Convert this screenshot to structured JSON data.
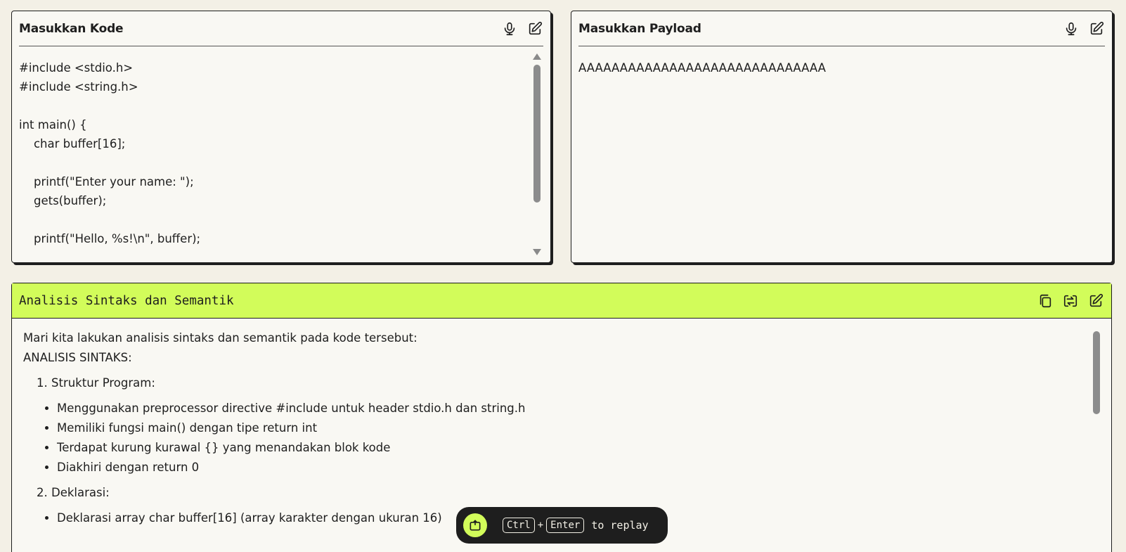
{
  "code_panel": {
    "title": "Masukkan Kode",
    "code": "#include <stdio.h>\n#include <string.h>\n\nint main() {\n    char buffer[16];\n\n    printf(\"Enter your name: \");\n    gets(buffer);\n\n    printf(\"Hello, %s!\\n\", buffer);"
  },
  "payload_panel": {
    "title": "Masukkan Payload",
    "payload": "AAAAAAAAAAAAAAAAAAAAAAAAAAAAAA"
  },
  "analysis_panel": {
    "title": "Analisis Sintaks dan Semantik",
    "intro": "Mari kita lakukan analisis sintaks dan semantik pada kode tersebut:",
    "section_heading": "ANALISIS SINTAKS:",
    "sections": [
      {
        "label": "Struktur Program:",
        "bullets": [
          "Menggunakan preprocessor directive #include untuk header stdio.h dan string.h",
          "Memiliki fungsi main() dengan tipe return int",
          "Terdapat kurung kurawal {} yang menandakan blok kode",
          "Diakhiri dengan return 0"
        ]
      },
      {
        "label": "Deklarasi:",
        "bullets": [
          "Deklarasi array char buffer[16] (array karakter dengan ukuran 16)"
        ]
      }
    ]
  },
  "replay_bar": {
    "key1": "Ctrl",
    "plus": "+",
    "key2": "Enter",
    "text": "to replay"
  },
  "colors": {
    "accent": "#d2fc5a",
    "background": "#f3f0e6",
    "panel": "#f9f8f3",
    "ink": "#1e1e1e"
  }
}
